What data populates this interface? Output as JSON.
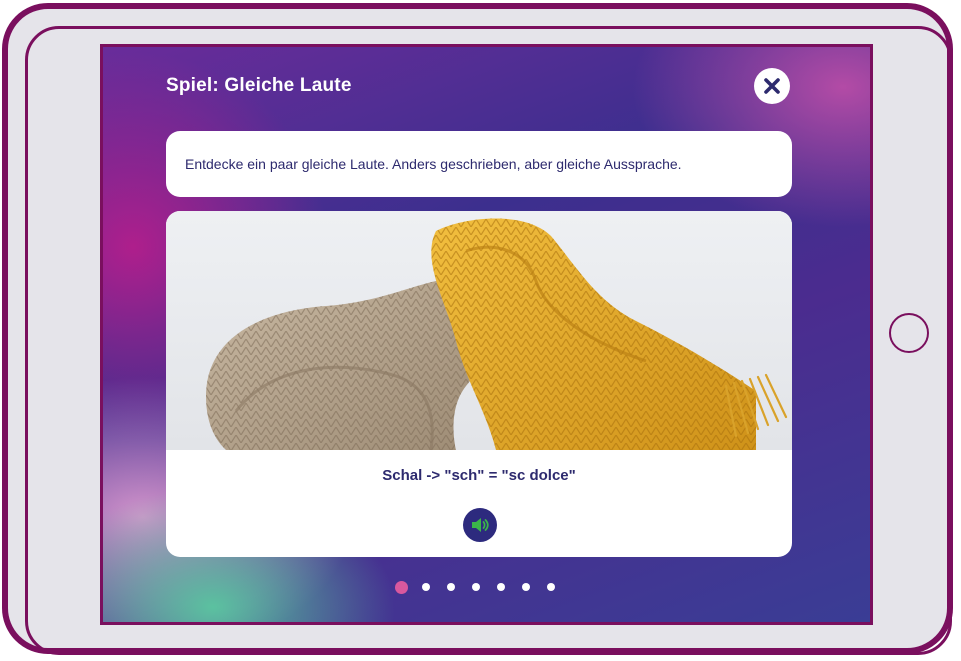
{
  "screen": {
    "title": "Spiel: Gleiche Laute",
    "instruction": "Entdecke ein paar gleiche Laute. Anders geschrieben, aber gleiche Aussprache.",
    "image": {
      "subject": "knitted scarves (beige and yellow)"
    },
    "caption": "Schal -> \"sch\" = \"sc dolce\"",
    "pagination": {
      "total": 7,
      "current": 1
    }
  },
  "icons": {
    "close": "close-icon",
    "audio": "speaker-icon",
    "home": "home-button-circle"
  },
  "colors": {
    "frame": "#7a0f5e",
    "device_bg": "#e5e4ea",
    "text_dark": "#2d2a6e",
    "audio_bg": "#2d2a7e",
    "audio_icon": "#3bb54a",
    "dot_active": "#d9589e",
    "dot_inactive": "#ffffff"
  }
}
